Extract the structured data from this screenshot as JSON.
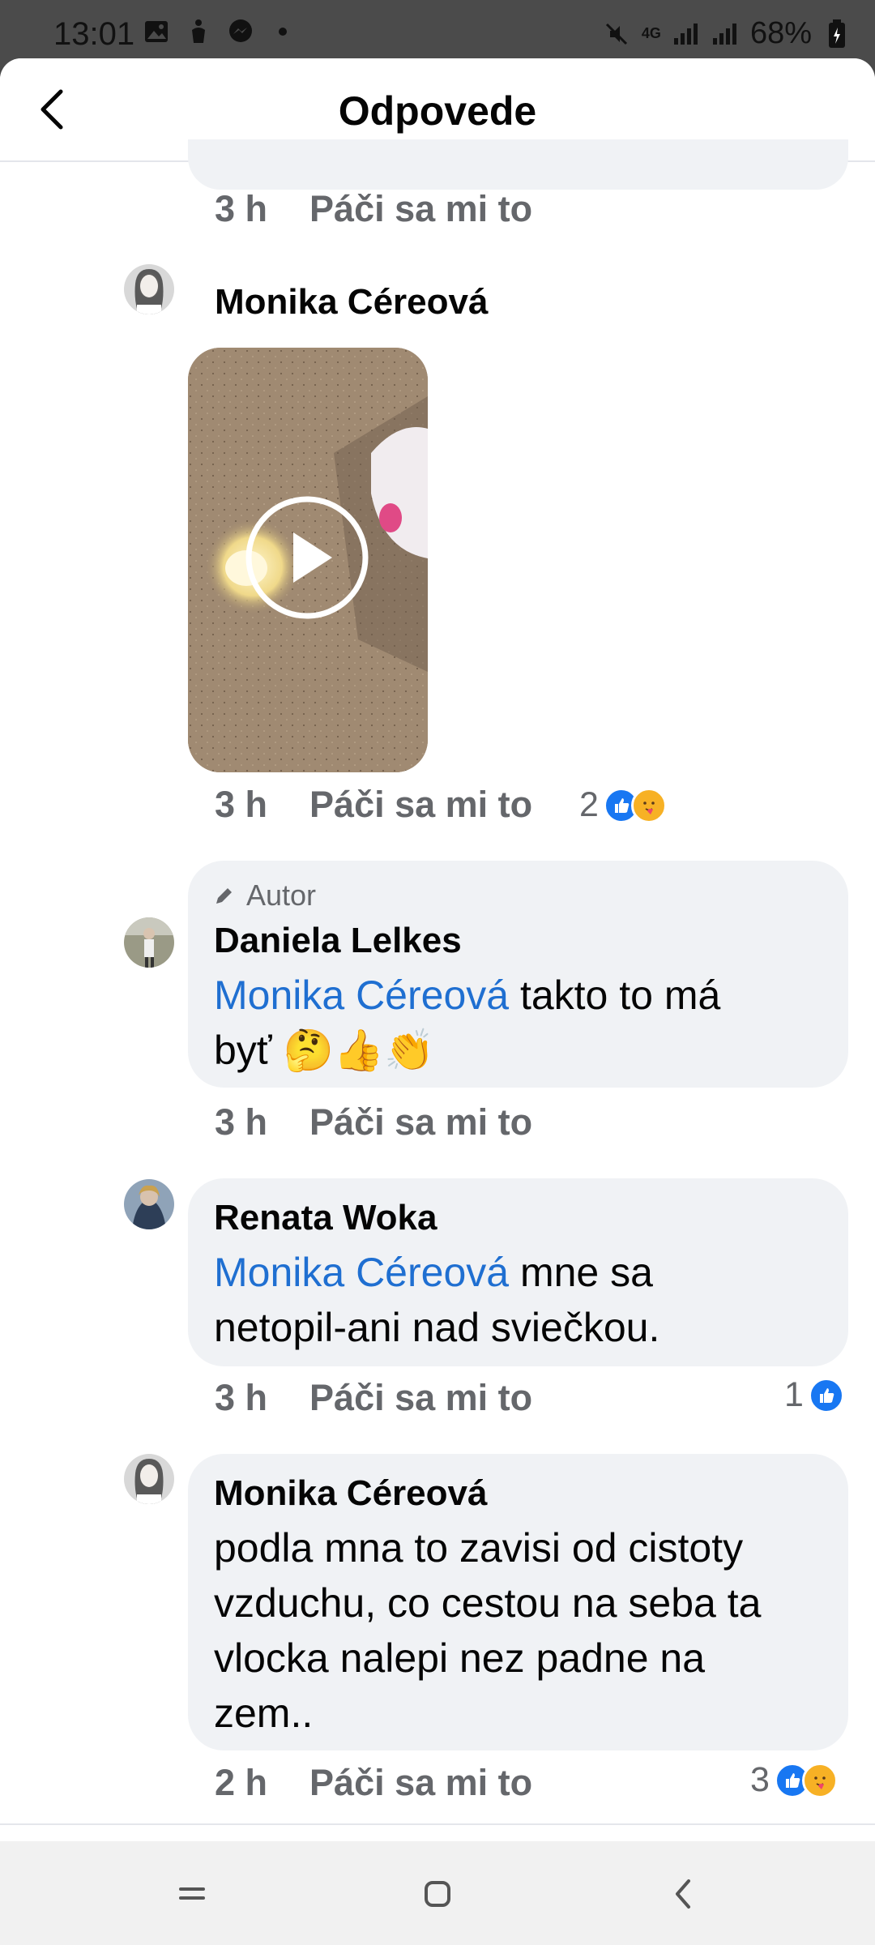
{
  "status_bar": {
    "time": "13:01",
    "battery": "68%",
    "network": "4G"
  },
  "header": {
    "title": "Odpovede",
    "back_icon": "chevron-left-icon"
  },
  "top_reply_meta": {
    "time": "3 h",
    "like": "Páči sa mi to"
  },
  "comments": [
    {
      "name": "Monika Céreová",
      "attachment": "video",
      "time": "3 h",
      "like": "Páči sa mi to",
      "reaction_count": "2",
      "reactions": [
        "like",
        "care"
      ]
    },
    {
      "badge": "Autor",
      "name": "Daniela Lelkes",
      "mention": "Monika Céreová",
      "text_line1": " takto to má",
      "text_line2": "byť 🤔👍👏",
      "time": "3 h",
      "like": "Páči sa mi to"
    },
    {
      "name": "Renata Woka",
      "mention": "Monika Céreová",
      "text_line1": " mne sa",
      "text_line2": "netopil-ani nad sviečkou.",
      "time": "3 h",
      "like": "Páči sa mi to",
      "reaction_count": "1",
      "reactions": [
        "like"
      ]
    },
    {
      "name": "Monika Céreová",
      "text_lines": [
        "podla mna to zavisi od cistoty",
        "vzduchu, co cestou na seba ta",
        "vlocka nalepi nez padne na",
        "zem.."
      ],
      "time": "2 h",
      "like": "Páči sa mi to",
      "reaction_count": "3",
      "reactions": [
        "like",
        "care"
      ]
    }
  ],
  "colors": {
    "mention": "#1f6fd1",
    "bubble": "#f0f2f5",
    "meta": "#65676b",
    "like": "#1877f2",
    "care": "#f7b125"
  }
}
